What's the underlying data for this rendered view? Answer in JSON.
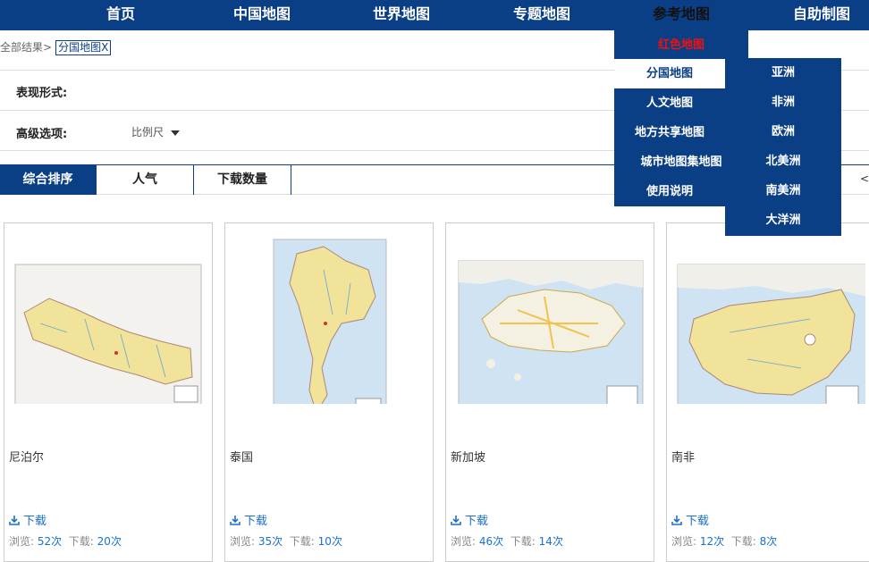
{
  "nav": [
    "首页",
    "中国地图",
    "世界地图",
    "专题地图",
    "参考地图",
    "自助制图"
  ],
  "breadcrumb": {
    "prefix": "全部结果>",
    "tag": "分国地图X"
  },
  "filters": {
    "form_label": "表现形式:",
    "advanced_label": "高级选项:",
    "scale_label": "比例尺"
  },
  "sort": {
    "tabs": [
      "综合排序",
      "人气",
      "下载数量"
    ],
    "prev": "<"
  },
  "cards": [
    {
      "title": "尼泊尔",
      "download": "下载",
      "views_label": "浏览:",
      "views": "52次",
      "dl_label": "下载:",
      "dls": "20次"
    },
    {
      "title": "泰国",
      "download": "下载",
      "views_label": "浏览:",
      "views": "35次",
      "dl_label": "下载:",
      "dls": "10次"
    },
    {
      "title": "新加坡",
      "download": "下载",
      "views_label": "浏览:",
      "views": "46次",
      "dl_label": "下载:",
      "dls": "14次"
    },
    {
      "title": "南非",
      "download": "下载",
      "views_label": "浏览:",
      "views": "12次",
      "dl_label": "下载:",
      "dls": "8次"
    }
  ],
  "dropdown": {
    "items": [
      "红色地图",
      "分国地图",
      "人文地图",
      "地方共享地图",
      "城市地图集地图",
      "使用说明"
    ],
    "sub": [
      "亚洲",
      "非洲",
      "欧洲",
      "北美洲",
      "南美洲",
      "大洋洲"
    ]
  },
  "colors": {
    "nav_bg": "#0b3f85",
    "link": "#1a6fd1",
    "red_item": "#e11111"
  }
}
